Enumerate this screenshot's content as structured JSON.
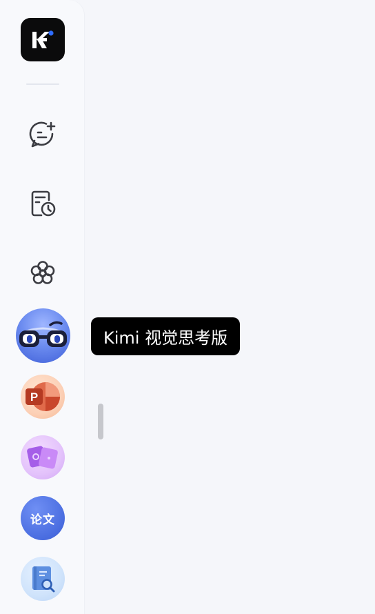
{
  "tooltip": {
    "text": "Kimi 视觉思考版"
  },
  "agents": {
    "paper_label": "论文"
  },
  "icons": {
    "logo": "kimi-logo-icon",
    "new_chat": "chat-bubble-plus-icon",
    "history": "document-clock-icon",
    "explore": "flower-icon",
    "kimi_agent": "glasses-avatar-icon",
    "ppt_agent": "powerpoint-icon",
    "image_agent": "image-cards-icon",
    "paper_agent": "paper-icon",
    "search_agent": "book-search-icon"
  },
  "colors": {
    "logo_bg": "#0b0b0c",
    "logo_dot": "#2e6bff",
    "tooltip_bg": "#000000",
    "page_bg": "#f5f6fa"
  }
}
